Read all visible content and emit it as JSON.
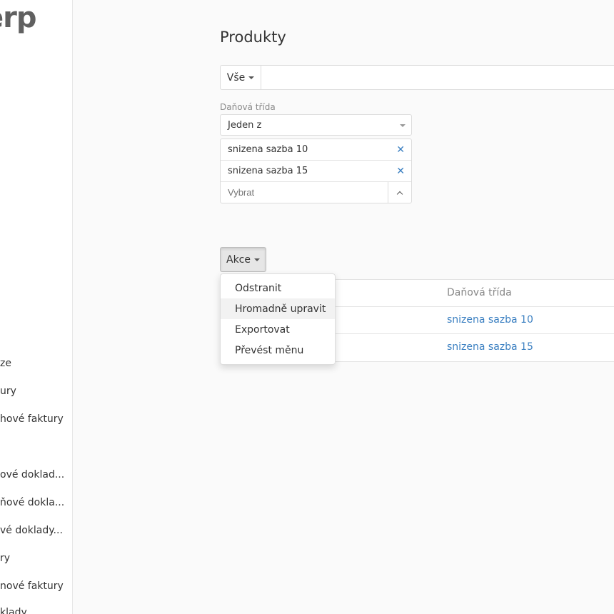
{
  "sidebar": {
    "logo": "erp",
    "items": [
      {
        "label": "ze"
      },
      {
        "label": "ury"
      },
      {
        "label": "hové faktury"
      },
      {
        "label": "ové doklad..."
      },
      {
        "label": "ňové dokla..."
      },
      {
        "label": "vé doklady..."
      },
      {
        "label": "ry"
      },
      {
        "label": "nové faktury"
      },
      {
        "label": "klady..."
      }
    ]
  },
  "page": {
    "title": "Produkty"
  },
  "search": {
    "scope_label": "Vše",
    "placeholder": "",
    "value": ""
  },
  "filter": {
    "label": "Daňová třída",
    "mode": "Jeden z",
    "selected": [
      "snizena sazba 10",
      "snizena sazba 15"
    ],
    "select_placeholder": "Vybrat",
    "remove_symbol": "✕"
  },
  "actions": {
    "button_label": "Akce",
    "menu": [
      "Odstranit",
      "Hromadně upravit",
      "Exportovat",
      "Převést měnu"
    ],
    "hover_index": 1
  },
  "table": {
    "header": "Daňová třída",
    "rows": [
      "snizena sazba 10",
      "snizena sazba 15"
    ]
  },
  "colors": {
    "link": "#3a7fc1",
    "sidebar_bg": "#ffffff",
    "page_bg": "#fafafa"
  }
}
